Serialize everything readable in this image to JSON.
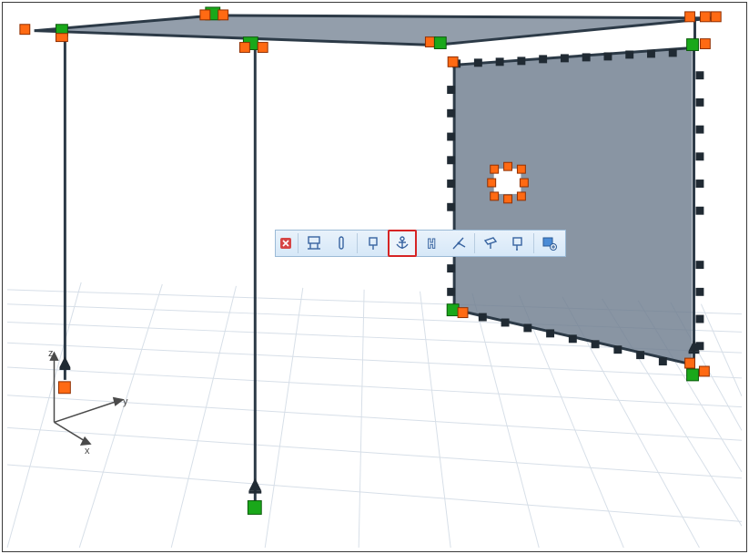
{
  "axes": {
    "x": "x",
    "y": "y",
    "z": "z"
  },
  "toolbar": {
    "close_title": "Close",
    "items": [
      {
        "name": "nodal-support-icon"
      },
      {
        "name": "column-icon"
      },
      {
        "name": "line-hinge-icon"
      },
      {
        "name": "anchor-icon"
      },
      {
        "name": "beam-release-icon"
      },
      {
        "name": "scissor-hinge-icon"
      },
      {
        "name": "surface-hinge-icon"
      },
      {
        "name": "surface-release-icon"
      },
      {
        "name": "display-settings-icon"
      }
    ],
    "selected_index": 3
  },
  "colors": {
    "structure_dark": "#2c3a47",
    "surface_fill": "#6f7e8f",
    "grid": "#cfd8e2",
    "node_orange": "#ff6a13",
    "node_green": "#1aa81a",
    "support_dark": "#202a33",
    "toolbar_border": "#9bbad6"
  }
}
